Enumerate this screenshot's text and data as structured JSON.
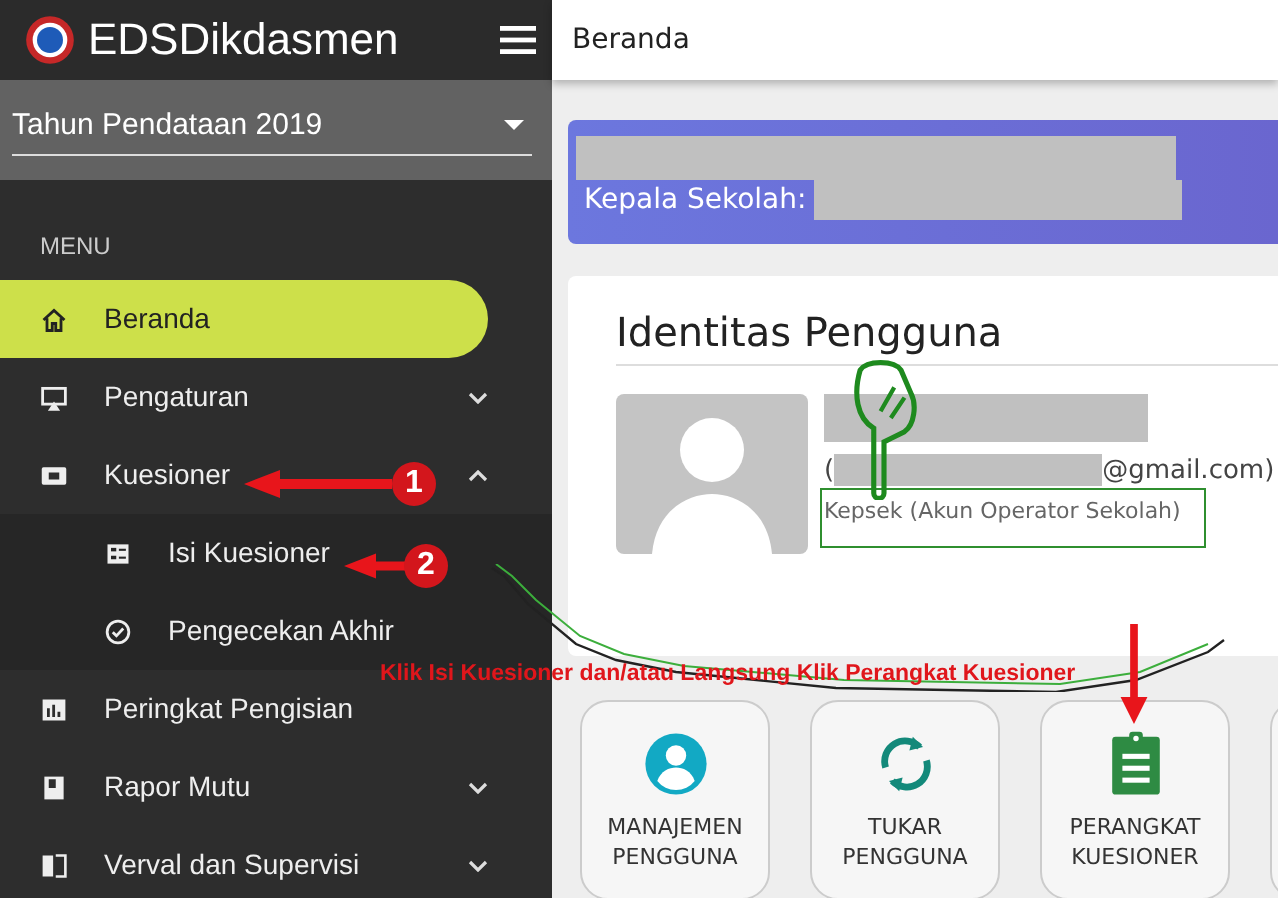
{
  "header": {
    "logo_text": "EDSDikdasmen"
  },
  "year_select": {
    "value": "Tahun Pendataan 2019"
  },
  "menu_label": "MENU",
  "menu": [
    {
      "label": "Beranda",
      "kind": "home",
      "selected": true
    },
    {
      "label": "Pengaturan",
      "kind": "monitor",
      "selected": false,
      "expanded": false
    },
    {
      "label": "Kuesioner",
      "kind": "ticket",
      "selected": false,
      "expanded": true,
      "children": [
        {
          "label": "Isi Kuesioner",
          "kind": "form",
          "selected": false
        },
        {
          "label": "Pengecekan Akhir",
          "kind": "check",
          "selected": false
        }
      ]
    },
    {
      "label": "Peringkat Pengisian",
      "kind": "chart",
      "selected": false
    },
    {
      "label": "Rapor Mutu",
      "kind": "book",
      "selected": false,
      "expanded": false
    },
    {
      "label": "Verval dan Supervisi",
      "kind": "swap",
      "selected": false,
      "expanded": false
    }
  ],
  "page_title": "Beranda",
  "banner": {
    "label": "Kepala Sekolah:"
  },
  "profile": {
    "title": "Identitas Pengguna",
    "email_open": "(",
    "email_domain": "@gmail.com)",
    "role": "Kepsek (Akun Operator Sekolah)"
  },
  "tiles": [
    {
      "label": "MANAJEMEN PENGGUNA",
      "kind": "person"
    },
    {
      "label": "TUKAR PENGGUNA",
      "kind": "sync"
    },
    {
      "label": "PERANGKAT KUESIONER",
      "kind": "clipboard"
    }
  ],
  "annotations": {
    "badges": [
      {
        "text": "1"
      },
      {
        "text": "2"
      }
    ],
    "caption": "Klik Isi Kuesioner dan/atau Langsung Klik Perangkat Kuesioner"
  }
}
